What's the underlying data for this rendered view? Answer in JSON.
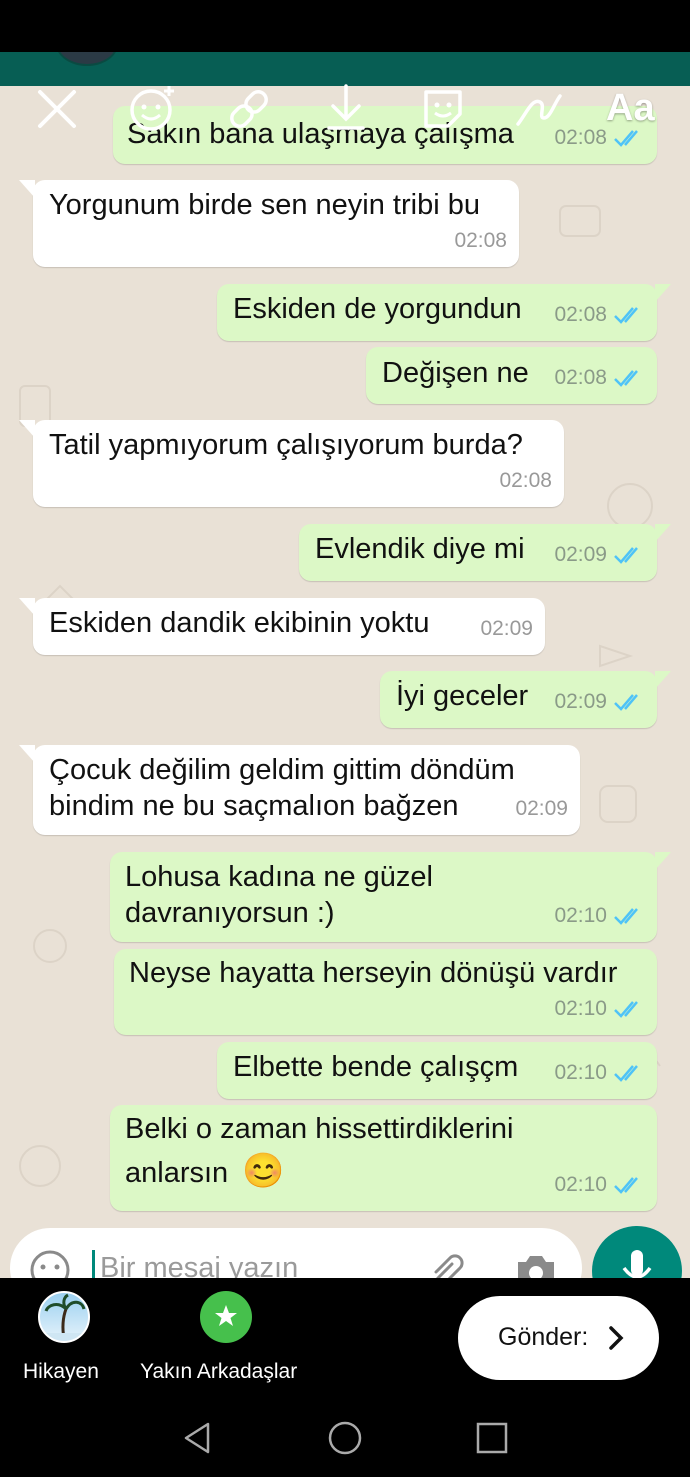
{
  "chat": {
    "messages": [
      {
        "text": "Sakın bana ulaşmaya çalışma",
        "time": "02:08",
        "dir": "out"
      },
      {
        "text": "Yorgunum birde sen neyin tribi bu",
        "time": "02:08",
        "dir": "in"
      },
      {
        "text": "Eskiden de yorgundun",
        "time": "02:08",
        "dir": "out"
      },
      {
        "text": "Değişen ne",
        "time": "02:08",
        "dir": "out"
      },
      {
        "text": "Tatil yapmıyorum çalışıyorum burda?",
        "time": "02:08",
        "dir": "in"
      },
      {
        "text": "Evlendik diye mi",
        "time": "02:09",
        "dir": "out"
      },
      {
        "text": "Eskiden dandik ekibinin yoktu",
        "time": "02:09",
        "dir": "in"
      },
      {
        "text": "İyi geceler",
        "time": "02:09",
        "dir": "out"
      },
      {
        "line1": "Çocuk değilim geldim gittim döndüm",
        "line2": "bindim ne bu saçmalıon bağzen",
        "time": "02:09",
        "dir": "in"
      },
      {
        "line1": "Lohusa kadına ne güzel",
        "line2": "davranıyorsun :)",
        "time": "02:10",
        "dir": "out"
      },
      {
        "text": "Neyse hayatta herseyin dönüşü vardır",
        "time": "02:10",
        "dir": "out"
      },
      {
        "text": "Elbette bende çalışçm",
        "time": "02:10",
        "dir": "out"
      },
      {
        "line1": "Belki o zaman hissettirdiklerini",
        "line2": "anlarsın",
        "emoji": "😊",
        "time": "02:10",
        "dir": "out"
      }
    ]
  },
  "editor": {
    "text_tool_label": "Aa",
    "tools": [
      "close-icon",
      "emoji-sticker-icon",
      "link-icon",
      "download-icon",
      "sticker-icon",
      "draw-icon",
      "text-icon"
    ]
  },
  "input": {
    "placeholder": "Bir mesaj yazın"
  },
  "share": {
    "targets": [
      {
        "label": "Hikayen",
        "icon": "story-avatar"
      },
      {
        "label": "Yakın Arkadaşlar",
        "icon": "star-icon"
      }
    ],
    "send_label": "Gönder:"
  },
  "colors": {
    "outgoing_bubble": "#dcf8c6",
    "incoming_bubble": "#ffffff",
    "chat_background": "#e9e1d6",
    "read_ticks": "#4fc3f7",
    "header": "#075e54",
    "close_friends": "#46c04c"
  }
}
